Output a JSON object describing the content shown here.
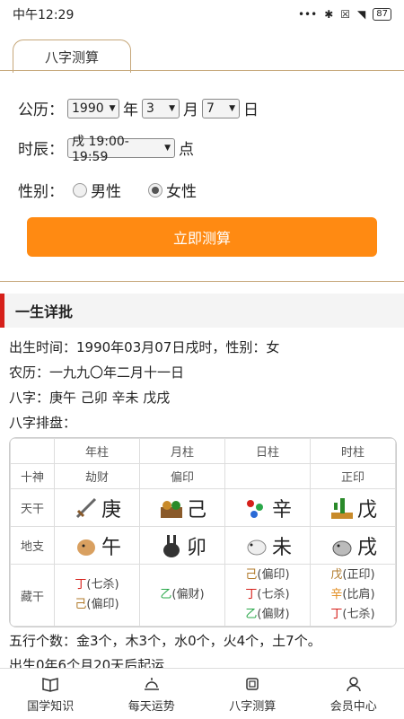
{
  "status": {
    "time": "中午12:29",
    "battery": "87"
  },
  "tab": {
    "label": "八字测算"
  },
  "form": {
    "solar_label": "公历：",
    "year_value": "1990",
    "year_unit": "年",
    "month_value": "3",
    "month_unit": "月",
    "day_value": "7",
    "day_unit": "日",
    "hour_label": "时辰：",
    "hour_value": "戌 19:00-19:59",
    "hour_unit": "点",
    "gender_label": "性别：",
    "male": "男性",
    "female": "女性",
    "selected_gender": "女性",
    "submit": "立即测算"
  },
  "section": {
    "title": "一生详批"
  },
  "info": {
    "birth": "出生时间：1990年03月07日戌时，性别：女",
    "lunar": "农历：一九九〇年二月十一日",
    "bazi": "八字：庚午 己卯 辛未 戊戌",
    "paipan": "八字排盘："
  },
  "table": {
    "headers": [
      "年柱",
      "月柱",
      "日柱",
      "时柱"
    ],
    "shishen_label": "十神",
    "shishen": [
      "劫财",
      "偏印",
      "",
      "正印"
    ],
    "tiangan_label": "天干",
    "tiangan": [
      "庚",
      "己",
      "辛",
      "戊"
    ],
    "dizhi_label": "地支",
    "dizhi": [
      "午",
      "卯",
      "未",
      "戌"
    ],
    "canggan_label": "藏干",
    "canggan": [
      [
        {
          "gan": "丁",
          "rel": "(七杀)",
          "color": "#d6201a"
        },
        {
          "gan": "己",
          "rel": "(偏印)",
          "color": "#b07a2a"
        }
      ],
      [
        {
          "gan": "乙",
          "rel": "(偏财)",
          "color": "#2aa84a"
        }
      ],
      [
        {
          "gan": "己",
          "rel": "(偏印)",
          "color": "#b07a2a"
        },
        {
          "gan": "丁",
          "rel": "(七杀)",
          "color": "#d6201a"
        },
        {
          "gan": "乙",
          "rel": "(偏财)",
          "color": "#2aa84a"
        }
      ],
      [
        {
          "gan": "戊",
          "rel": "(正印)",
          "color": "#b07a2a"
        },
        {
          "gan": "辛",
          "rel": "(比肩)",
          "color": "#e08a1a"
        },
        {
          "gan": "丁",
          "rel": "(七杀)",
          "color": "#d6201a"
        }
      ]
    ]
  },
  "wuxing": "五行个数：金3个，木3个，水0个，火4个，土7个。",
  "qiyun": "出生0年6个月20天后起运",
  "nav": [
    {
      "label": "国学知识",
      "icon": "book-icon"
    },
    {
      "label": "每天运势",
      "icon": "sunrise-icon"
    },
    {
      "label": "八字测算",
      "icon": "chip-icon"
    },
    {
      "label": "会员中心",
      "icon": "user-icon"
    }
  ]
}
